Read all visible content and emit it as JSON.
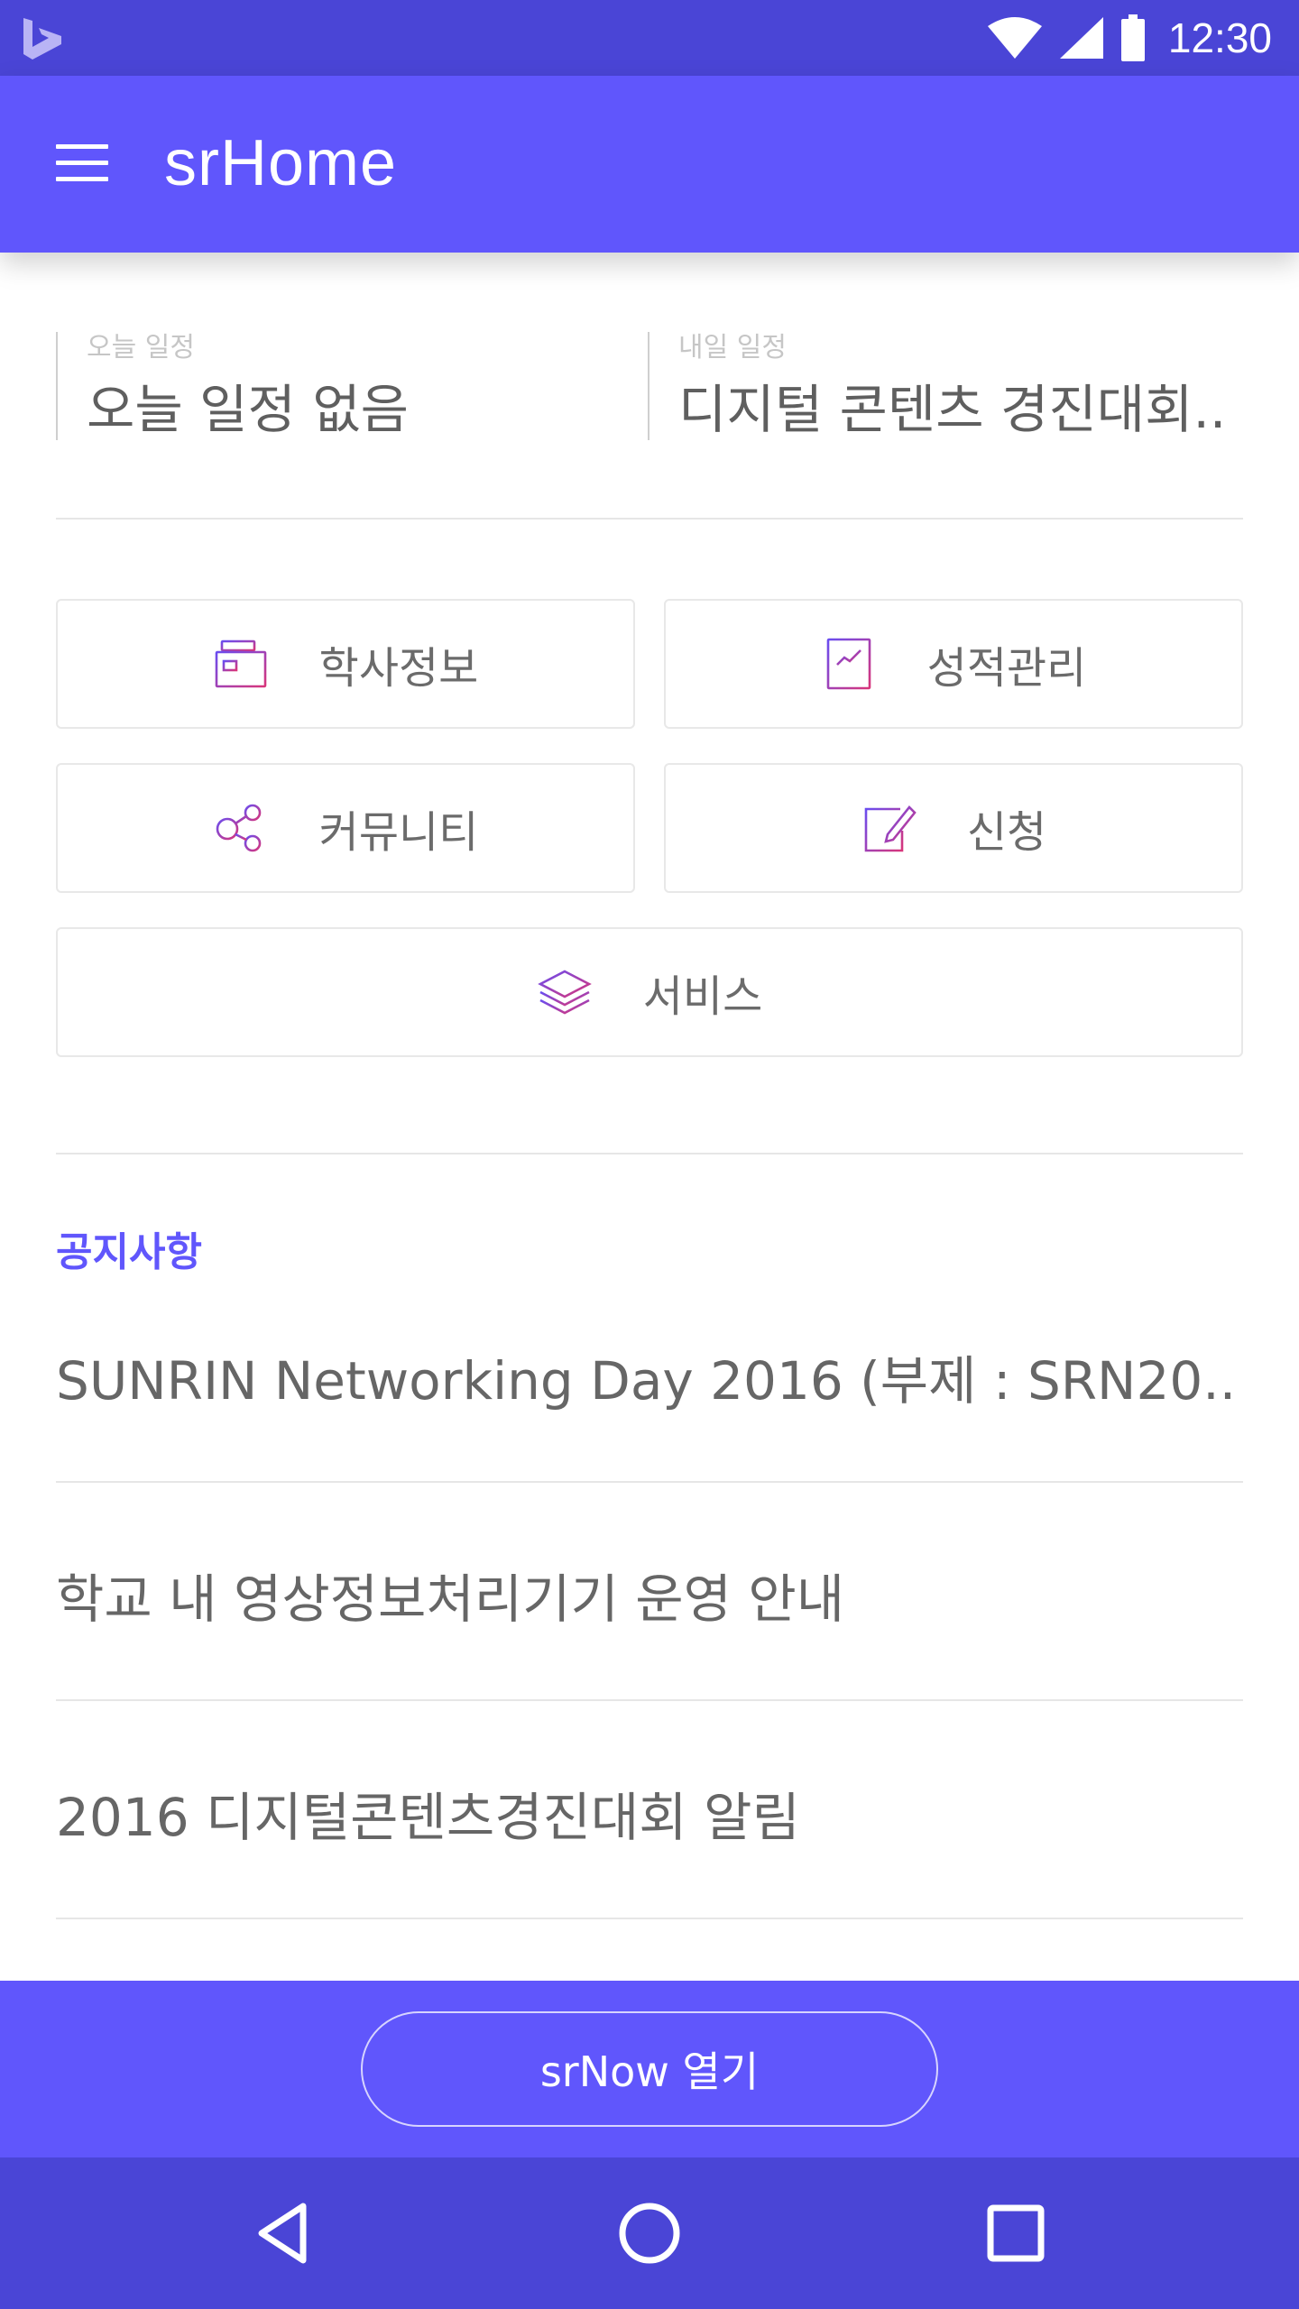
{
  "status_bar": {
    "time": "12:30",
    "left_icon": "bing-icon",
    "icons": [
      "wifi-icon",
      "cellular-signal-icon",
      "battery-icon"
    ]
  },
  "app_bar": {
    "title": "srHome",
    "menu_icon": "hamburger-menu-icon"
  },
  "schedule": {
    "today_label": "오늘 일정",
    "today_value": "오늘 일정 없음",
    "tomorrow_label": "내일 일정",
    "tomorrow_value": "디지털 콘텐츠 경진대회.."
  },
  "menu": {
    "items": [
      {
        "label": "학사정보",
        "icon": "academic-info-icon"
      },
      {
        "label": "성적관리",
        "icon": "grades-chart-icon"
      },
      {
        "label": "커뮤니티",
        "icon": "community-icon"
      },
      {
        "label": "신청",
        "icon": "application-edit-icon"
      },
      {
        "label": "서비스",
        "icon": "layers-icon"
      }
    ]
  },
  "notices": {
    "title": "공지사항",
    "items": [
      "SUNRIN Networking Day 2016 (부제 : SRN20..",
      "학교 내 영상정보처리기기 운영 안내",
      "2016 디지털콘텐츠경진대회 알림"
    ]
  },
  "bottom_action": {
    "label": "srNow 열기"
  },
  "nav_bar": {
    "icons": [
      "back-icon",
      "home-icon",
      "recents-icon"
    ]
  },
  "colors": {
    "primary": "#6056fc",
    "primary_dark": "#4a45d6",
    "accent_gradient_start": "#6a4df0",
    "accent_gradient_end": "#d8357a"
  }
}
